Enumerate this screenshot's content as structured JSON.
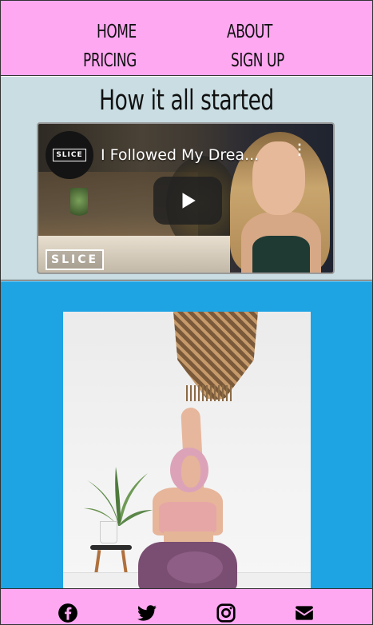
{
  "nav": {
    "links": [
      {
        "label": "HOME"
      },
      {
        "label": "ABOUT"
      },
      {
        "label": "PRICING"
      },
      {
        "label": "SIGN UP"
      }
    ]
  },
  "story": {
    "heading": "How it all started",
    "video": {
      "channel_badge": "SLICE",
      "title": "I Followed My Drea...",
      "watermark": "SLICE",
      "play_icon": "play-icon",
      "more_icon": "more-vert-icon"
    }
  },
  "hero": {
    "image": "yoga-pose-photo"
  },
  "footer": {
    "icons": [
      "facebook-icon",
      "twitter-icon",
      "instagram-icon",
      "email-icon"
    ]
  },
  "colors": {
    "nav_bg": "#ffa8f2",
    "story_bg": "#c9dde2",
    "hero_bg": "#1ea3e3",
    "footer_bg": "#ffa8f2"
  }
}
